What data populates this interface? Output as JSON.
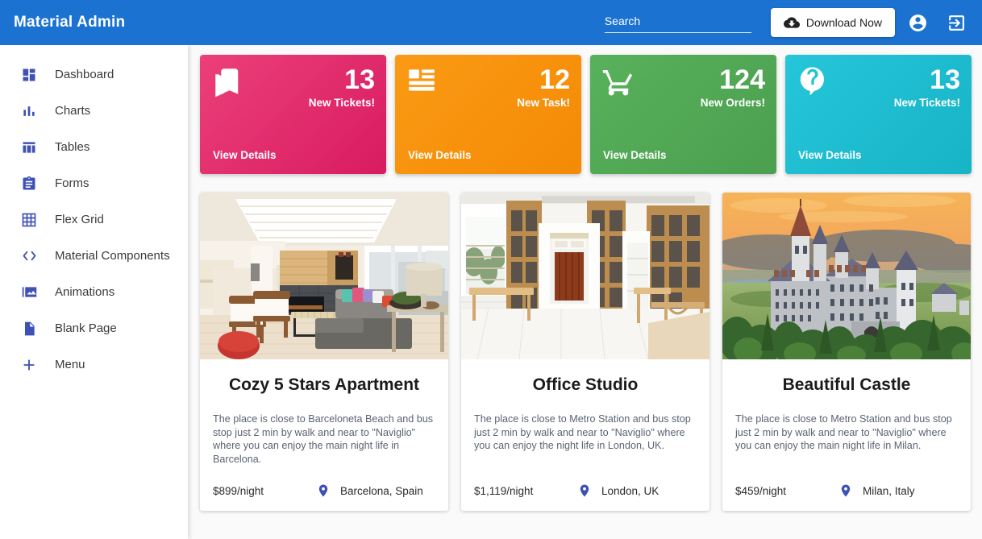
{
  "header": {
    "brand": "Material Admin",
    "search": {
      "placeholder": "Search",
      "value": ""
    },
    "download_label": "Download Now",
    "icons": {
      "cloud_download": "cloud-download-icon",
      "account": "account-circle-icon",
      "login": "login-exit-to-app-icon"
    }
  },
  "sidebar": {
    "items": [
      {
        "label": "Dashboard",
        "icon": "dashboard-icon"
      },
      {
        "label": "Charts",
        "icon": "bar-chart-icon"
      },
      {
        "label": "Tables",
        "icon": "table-icon"
      },
      {
        "label": "Forms",
        "icon": "clipboard-forms-icon"
      },
      {
        "label": "Flex Grid",
        "icon": "grid-icon"
      },
      {
        "label": "Material Components",
        "icon": "code-brackets-icon"
      },
      {
        "label": "Animations",
        "icon": "image-animations-icon"
      },
      {
        "label": "Blank Page",
        "icon": "page-icon"
      },
      {
        "label": "Menu",
        "icon": "plus-icon"
      }
    ]
  },
  "stat_cards": [
    {
      "value": "13",
      "label": "New Tickets!",
      "link": "View Details",
      "icon": "bookmarks-icon",
      "color": "#e0326f",
      "theme": "c-pink"
    },
    {
      "value": "12",
      "label": "New Task!",
      "link": "View Details",
      "icon": "list-view-icon",
      "color": "#f99113",
      "theme": "c-orange"
    },
    {
      "value": "124",
      "label": "New Orders!",
      "link": "View Details",
      "icon": "shopping-cart-icon",
      "color": "#52a857",
      "theme": "c-green"
    },
    {
      "value": "13",
      "label": "New Tickets!",
      "link": "View Details",
      "icon": "live-help-icon",
      "color": "#21bed3",
      "theme": "c-cyan"
    }
  ],
  "properties": [
    {
      "title": "Cozy 5 Stars Apartment",
      "description": "The place is close to Barceloneta Beach and bus stop just 2 min by walk and near to \"Naviglio\" where you can enjoy the main night life in Barcelona.",
      "price": "$899/night",
      "location": "Barcelona, Spain",
      "image_alt": "modern-living-room-photo"
    },
    {
      "title": "Office Studio",
      "description": "The place is close to Metro Station and bus stop just 2 min by walk and near to \"Naviglio\" where you can enjoy the night life in London, UK.",
      "price": "$1,119/night",
      "location": "London, UK",
      "image_alt": "white-office-studio-with-wooden-shelves-photo"
    },
    {
      "title": "Beautiful Castle",
      "description": "The place is close to Metro Station and bus stop just 2 min by walk and near to \"Naviglio\" where you can enjoy the main night life in Milan.",
      "price": "$459/night",
      "location": "Milan, Italy",
      "image_alt": "castle-on-hill-at-sunset-photo"
    }
  ],
  "colors": {
    "header_blue": "#1b72d0",
    "accent_indigo": "#3f51b5",
    "page_background": "#fafafa"
  }
}
